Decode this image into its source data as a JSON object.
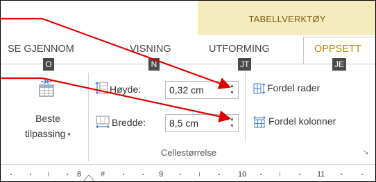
{
  "contextual": {
    "title": "TABELLVERKTØY"
  },
  "tabs": [
    {
      "label": "SE GJENNOM",
      "active": false
    },
    {
      "label": "VISNING",
      "active": false
    },
    {
      "label": "UTFORMING",
      "active": false
    },
    {
      "label": "OPPSETT",
      "active": true
    }
  ],
  "keytips": [
    "O",
    "N",
    "JT",
    "JE"
  ],
  "autofit": {
    "line1": "Beste",
    "line2": "tilpassing",
    "dropdown": "▾"
  },
  "height_row": {
    "label": "Høyde:",
    "value": "0,32 cm"
  },
  "width_row": {
    "label": "Bredde:",
    "value": "8,5 cm"
  },
  "distribute_rows": {
    "label": "Fordel rader"
  },
  "distribute_columns": {
    "label": "Fordel kolonner"
  },
  "group": {
    "label": "Cellestørrelse",
    "launcher": "↘"
  },
  "ruler": {
    "numbers": [
      "8",
      "9",
      "10",
      "11"
    ],
    "marker": "#"
  },
  "colors": {
    "contextual_band": "#f5ecbd",
    "contextual_text": "#7a5a14",
    "active_tab": "#b8860b",
    "arrow": "#e00000",
    "keytip_bg": "#4a4a4a"
  },
  "icons": [
    "autofit-table-icon",
    "row-height-icon",
    "column-width-icon",
    "distribute-rows-icon",
    "distribute-columns-icon",
    "spin-up-icon",
    "spin-down-icon",
    "dialog-launcher-icon"
  ]
}
